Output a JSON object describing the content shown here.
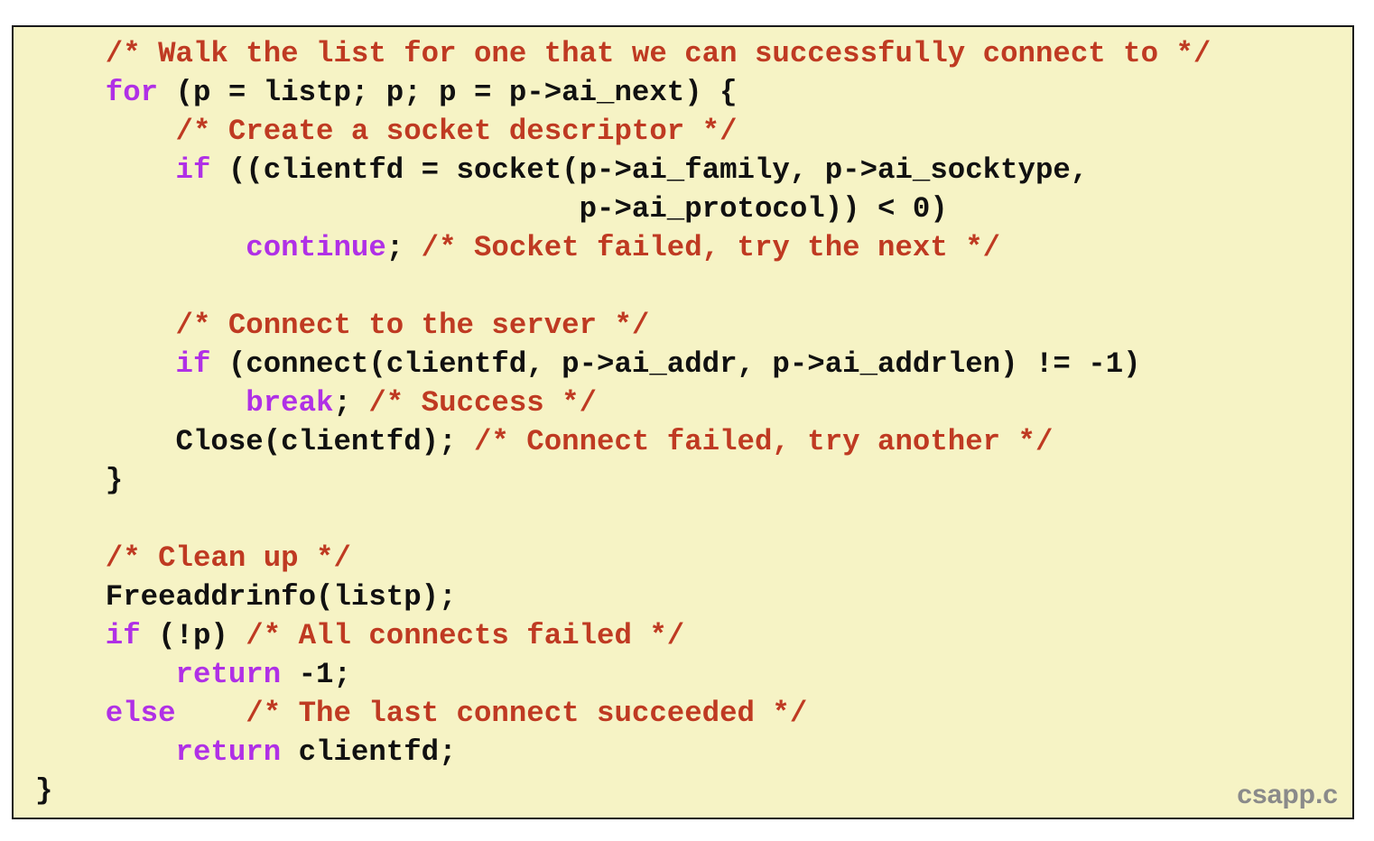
{
  "code": {
    "lines": [
      [
        {
          "t": "    ",
          "k": "tx"
        },
        {
          "t": "/* Walk the list for one that we can successfully connect to */",
          "k": "cm"
        }
      ],
      [
        {
          "t": "    ",
          "k": "tx"
        },
        {
          "t": "for",
          "k": "kw"
        },
        {
          "t": " (p = listp; p; p = p->ai_next) {",
          "k": "tx"
        }
      ],
      [
        {
          "t": "        ",
          "k": "tx"
        },
        {
          "t": "/* Create a socket descriptor */",
          "k": "cm"
        }
      ],
      [
        {
          "t": "        ",
          "k": "tx"
        },
        {
          "t": "if",
          "k": "kw"
        },
        {
          "t": " ((clientfd = socket(p->ai_family, p->ai_socktype,",
          "k": "tx"
        }
      ],
      [
        {
          "t": "                               p->ai_protocol)) < 0)",
          "k": "tx"
        }
      ],
      [
        {
          "t": "            ",
          "k": "tx"
        },
        {
          "t": "continue",
          "k": "kw"
        },
        {
          "t": "; ",
          "k": "tx"
        },
        {
          "t": "/* Socket failed, try the next */",
          "k": "cm"
        }
      ],
      [],
      [
        {
          "t": "        ",
          "k": "tx"
        },
        {
          "t": "/* Connect to the server */",
          "k": "cm"
        }
      ],
      [
        {
          "t": "        ",
          "k": "tx"
        },
        {
          "t": "if",
          "k": "kw"
        },
        {
          "t": " (connect(clientfd, p->ai_addr, p->ai_addrlen) != -1)",
          "k": "tx"
        }
      ],
      [
        {
          "t": "            ",
          "k": "tx"
        },
        {
          "t": "break",
          "k": "kw"
        },
        {
          "t": "; ",
          "k": "tx"
        },
        {
          "t": "/* Success */",
          "k": "cm"
        }
      ],
      [
        {
          "t": "        Close(clientfd); ",
          "k": "tx"
        },
        {
          "t": "/* Connect failed, try another */",
          "k": "cm"
        }
      ],
      [
        {
          "t": "    }",
          "k": "tx"
        }
      ],
      [],
      [
        {
          "t": "    ",
          "k": "tx"
        },
        {
          "t": "/* Clean up */",
          "k": "cm"
        }
      ],
      [
        {
          "t": "    Freeaddrinfo(listp);",
          "k": "tx"
        }
      ],
      [
        {
          "t": "    ",
          "k": "tx"
        },
        {
          "t": "if",
          "k": "kw"
        },
        {
          "t": " (!p) ",
          "k": "tx"
        },
        {
          "t": "/* All connects failed */",
          "k": "cm"
        }
      ],
      [
        {
          "t": "        ",
          "k": "tx"
        },
        {
          "t": "return",
          "k": "kw"
        },
        {
          "t": " -1;",
          "k": "tx"
        }
      ],
      [
        {
          "t": "    ",
          "k": "tx"
        },
        {
          "t": "else",
          "k": "kw"
        },
        {
          "t": "    ",
          "k": "tx"
        },
        {
          "t": "/* The last connect succeeded */",
          "k": "cm"
        }
      ],
      [
        {
          "t": "        ",
          "k": "tx"
        },
        {
          "t": "return",
          "k": "kw"
        },
        {
          "t": " clientfd;",
          "k": "tx"
        }
      ],
      [
        {
          "t": "}",
          "k": "tx"
        }
      ]
    ]
  },
  "filename": "csapp.c",
  "colors": {
    "background": "#f6f3c5",
    "keyword": "#b030e6",
    "comment": "#bf3a22",
    "text": "#111111",
    "filename": "#8a8a8a"
  }
}
